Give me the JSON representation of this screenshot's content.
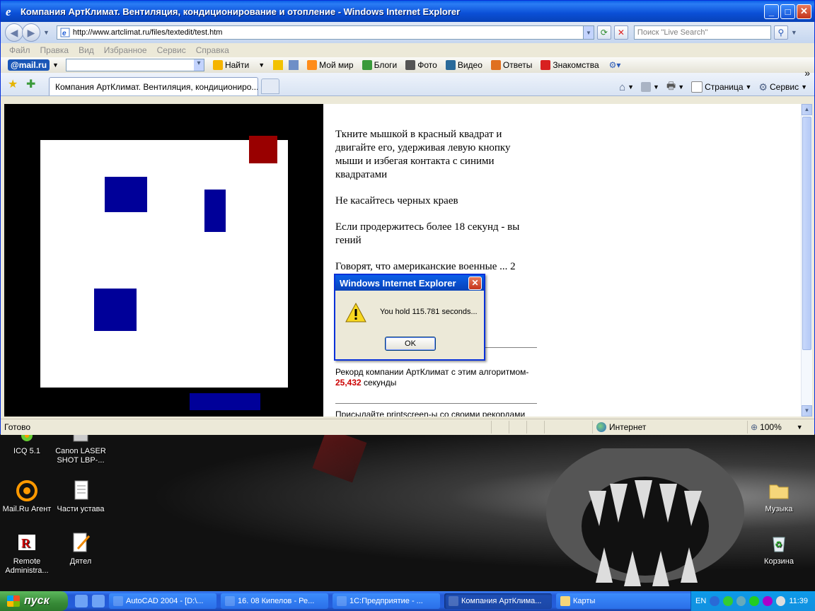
{
  "window": {
    "title": "Компания АртКлимат. Вентиляция, кондиционирование и отопление - Windows Internet Explorer",
    "address": "http://www.artclimat.ru/files/textedit/test.htm",
    "search_placeholder": "Поиск \"Live Search\""
  },
  "menu": [
    "Файл",
    "Правка",
    "Вид",
    "Избранное",
    "Сервис",
    "Справка"
  ],
  "mailru_toolbar": {
    "logo": "@mail.ru",
    "items": [
      "Найти",
      "Мой мир",
      "Блоги",
      "Фото",
      "Видео",
      "Ответы",
      "Знакомства"
    ]
  },
  "tab": {
    "label": "Компания АртКлимат. Вентиляция, кондициониро..."
  },
  "command_bar": {
    "page": "Страница",
    "tools": "Сервис"
  },
  "page": {
    "instructions": [
      "Ткните мышкой в красный квадрат и двигайте его, удерживая левую кнопку мыши и избегая контакта с синими квадратами",
      "Не касайтесь черных краев",
      "Если продержитесь более 18 секунд - вы гений",
      "Говорят, что американские военные ... 2 минут ...удящихся! ...жный!!"
    ],
    "record_text": "Рекорд компании АртКлимат с этим алгоритмом-",
    "record_value": "25,432",
    "record_unit": "секунды",
    "send_text": "Присылайте printscreen-ы со своими рекордами"
  },
  "status": {
    "text": "Готово",
    "zone": "Интернет",
    "zoom": "100%"
  },
  "dialog": {
    "title": "Windows Internet Explorer",
    "message": "You hold 115.781 seconds...",
    "ok": "OK"
  },
  "desktop_icons": [
    {
      "label": "ICQ 5.1"
    },
    {
      "label": "Canon LASER SHOT LBP-..."
    },
    {
      "label": "Mail.Ru Агент"
    },
    {
      "label": "Части устава"
    },
    {
      "label": "Remote Administra..."
    },
    {
      "label": "Дятел"
    },
    {
      "label": "Музыка"
    },
    {
      "label": "Корзина"
    }
  ],
  "taskbar": {
    "start": "пуск",
    "buttons": [
      "AutoCAD 2004 - [D:\\...",
      "16. 08 Кипелов - Ре...",
      "1С:Предприятие - ...",
      "Компания АртКлима...",
      "Карты"
    ],
    "lang": "EN",
    "clock": "11:39"
  },
  "colors": {
    "red_square": "#990000",
    "blue_block": "#000099",
    "game_border": "#000000"
  }
}
